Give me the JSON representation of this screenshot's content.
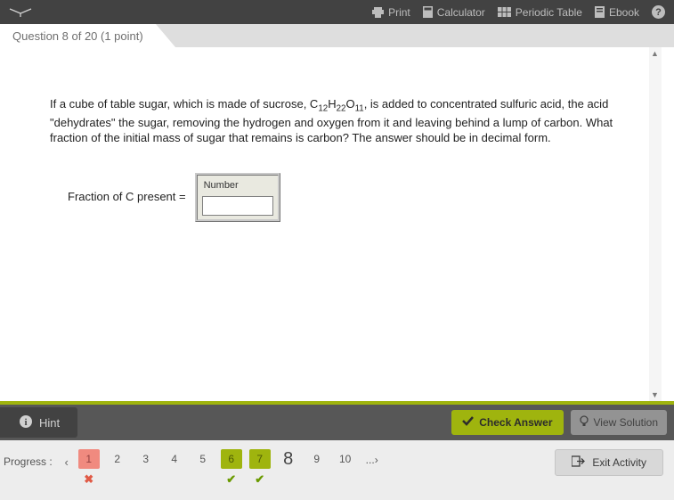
{
  "toolbar": {
    "print": "Print",
    "calculator": "Calculator",
    "periodic_table": "Periodic Table",
    "ebook": "Ebook"
  },
  "question_header": "Question 8 of 20 (1 point)",
  "question": {
    "pre": "If a cube of table sugar, which is made of sucrose, C",
    "s1": "12",
    "mid1": "H",
    "s2": "22",
    "mid2": "O",
    "s3": "11",
    "post": ", is added to concentrated sulfuric acid, the acid \"dehydrates\" the sugar, removing the hydrogen and oxygen from it and leaving behind a lump of carbon. What fraction of the initial mass of sugar that remains is carbon? The answer should be in decimal form."
  },
  "answer": {
    "label": "Fraction of C present =",
    "field_label": "Number",
    "value": ""
  },
  "actions": {
    "hint": "Hint",
    "check": "Check Answer",
    "view": "View Solution"
  },
  "progress": {
    "label": "Progress :",
    "items": [
      {
        "n": "1",
        "state": "wrong"
      },
      {
        "n": "2",
        "state": ""
      },
      {
        "n": "3",
        "state": ""
      },
      {
        "n": "4",
        "state": ""
      },
      {
        "n": "5",
        "state": ""
      },
      {
        "n": "6",
        "state": "correct"
      },
      {
        "n": "7",
        "state": "correct"
      },
      {
        "n": "8",
        "state": "current"
      },
      {
        "n": "9",
        "state": ""
      },
      {
        "n": "10",
        "state": ""
      }
    ],
    "more": "...",
    "exit": "Exit Activity"
  }
}
